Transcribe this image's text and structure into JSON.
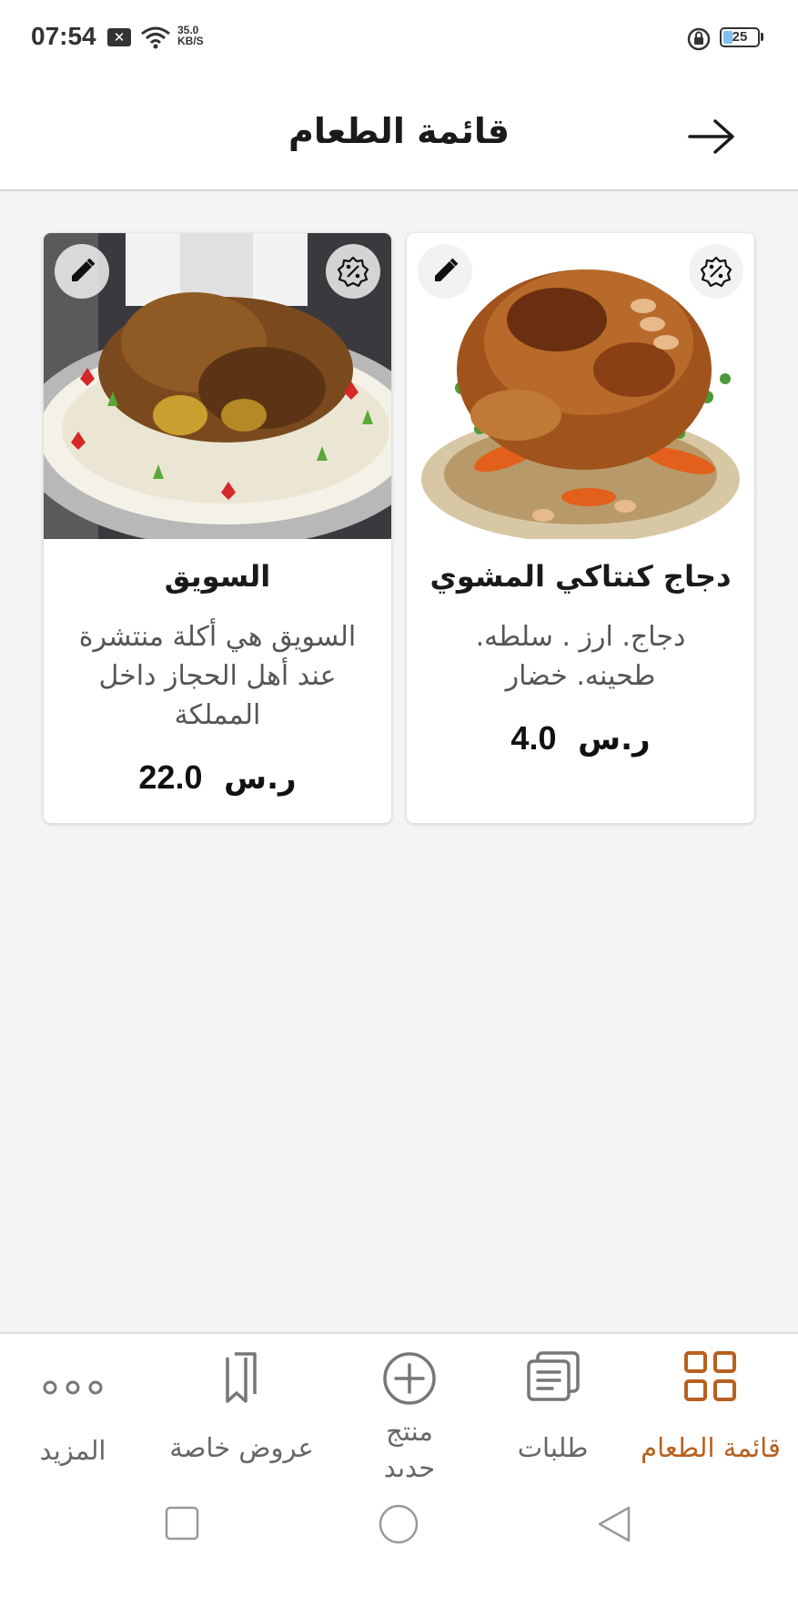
{
  "status_bar": {
    "time": "07:54",
    "notif_icon": "x-icon",
    "speed_value": "35.0",
    "speed_unit": "KB/S",
    "battery": "25"
  },
  "header": {
    "title": "قائمة الطعام",
    "back_icon": "arrow-right-icon"
  },
  "products": [
    {
      "name": "دجاج كنتاكي المشوي",
      "description": "دجاج. ارز . سلطه. طحينه. خضار",
      "price": "4.0",
      "currency": "ر.س"
    },
    {
      "name": "السويق",
      "description": "السويق هي أكلة منتشرة عند أهل الحجاز داخل المملكة",
      "price": "22.0",
      "currency": "ر.س"
    }
  ],
  "bottom_nav": {
    "active_color": "#b8601f",
    "items": [
      {
        "label": "قائمة الطعام",
        "icon": "grid-icon"
      },
      {
        "label": "طلبات",
        "icon": "orders-icon"
      },
      {
        "label": "منتج جديد",
        "icon": "add-circle-icon"
      },
      {
        "label": "عروض خاصة",
        "icon": "bookmarks-icon"
      },
      {
        "label": "المزيد",
        "icon": "more-icon"
      }
    ]
  }
}
